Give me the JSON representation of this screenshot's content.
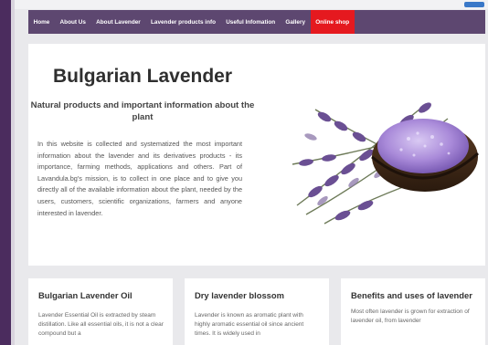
{
  "nav": {
    "items": [
      {
        "label": "Home"
      },
      {
        "label": "About Us"
      },
      {
        "label": "About Lavender"
      },
      {
        "label": "Lavender products info"
      },
      {
        "label": "Useful Infomation"
      },
      {
        "label": "Gallery"
      },
      {
        "label": "Online shop",
        "active": true
      }
    ],
    "bg_color": "#5d4770",
    "active_color": "#e5191f"
  },
  "hero": {
    "title": "Bulgarian Lavender",
    "subtitle": "Natural products and important information about the plant",
    "body": "In this website is collected and systematized the most important information about the lavender and its derivatives products - its importance, farming methods, applications and others. Part of Lavandula.bg's mission, is to collect in one place and to give you directly all of the available information about the plant, needed by the users, customers, scientific organizations, farmers and anyone interested in lavender."
  },
  "cards": [
    {
      "title": "Bulgarian Lavender Oil",
      "text": "Lavender Essential Oil is extracted by steam distillation. Like all essential oils, it is not a clear compound but a"
    },
    {
      "title": "Dry lavender blossom",
      "text": "Lavender is known as aromatic plant with highly aromatic essential oil since ancient times. It is widely used in"
    },
    {
      "title": "Benefits and uses of lavender",
      "text": "Most often lavender is grown for extraction of lavender oil, from lavender"
    }
  ]
}
